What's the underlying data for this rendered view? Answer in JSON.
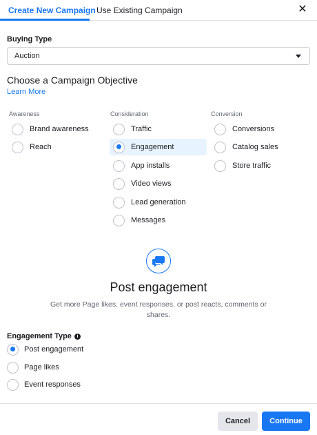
{
  "tabs": {
    "active_label": "Create New Campaign",
    "other_label": "Use Existing Campaign"
  },
  "close_icon": "close-icon",
  "buying_type": {
    "label": "Buying Type",
    "value": "Auction"
  },
  "objective": {
    "heading": "Choose a Campaign Objective",
    "learn_more": "Learn More",
    "columns": [
      {
        "title": "Awareness",
        "options": [
          {
            "label": "Brand awareness",
            "checked": false
          },
          {
            "label": "Reach",
            "checked": false
          }
        ]
      },
      {
        "title": "Consideration",
        "options": [
          {
            "label": "Traffic",
            "checked": false
          },
          {
            "label": "Engagement",
            "checked": true
          },
          {
            "label": "App installs",
            "checked": false
          },
          {
            "label": "Video views",
            "checked": false
          },
          {
            "label": "Lead generation",
            "checked": false
          },
          {
            "label": "Messages",
            "checked": false
          }
        ]
      },
      {
        "title": "Conversion",
        "options": [
          {
            "label": "Conversions",
            "checked": false
          },
          {
            "label": "Catalog sales",
            "checked": false
          },
          {
            "label": "Store traffic",
            "checked": false
          }
        ]
      }
    ]
  },
  "selected_objective": {
    "icon": "chat-bubbles-icon",
    "title": "Post engagement",
    "description": "Get more Page likes, event responses, or post reacts, comments or shares."
  },
  "engagement_type": {
    "label": "Engagement Type",
    "info_icon": "info-icon",
    "options": [
      {
        "label": "Post engagement",
        "checked": true
      },
      {
        "label": "Page likes",
        "checked": false
      },
      {
        "label": "Event responses",
        "checked": false
      }
    ]
  },
  "footer": {
    "cancel_label": "Cancel",
    "continue_label": "Continue"
  },
  "colors": {
    "accent": "#1877f2",
    "selected_bg": "#e7f3ff"
  }
}
